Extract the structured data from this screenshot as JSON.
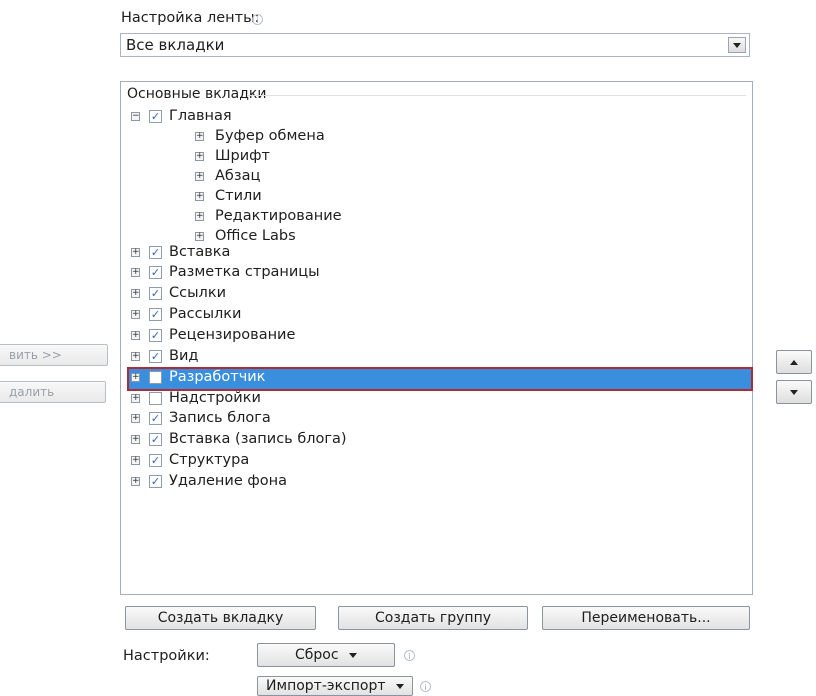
{
  "ribbon_setting": {
    "label": "Настройка ленты:",
    "selected": "Все вкладки"
  },
  "tree": {
    "header": "Основные вкладки",
    "rows": [
      {
        "label": "Главная",
        "level": 0,
        "expander": "−",
        "checked": true
      },
      {
        "label": "Буфер обмена",
        "level": 1,
        "expander": "+"
      },
      {
        "label": "Шрифт",
        "level": 1,
        "expander": "+"
      },
      {
        "label": "Абзац",
        "level": 1,
        "expander": "+"
      },
      {
        "label": "Стили",
        "level": 1,
        "expander": "+"
      },
      {
        "label": "Редактирование",
        "level": 1,
        "expander": "+"
      },
      {
        "label": "Office Labs",
        "level": 1,
        "expander": "+"
      },
      {
        "label": "Вставка",
        "level": 0,
        "expander": "+",
        "checked": true
      },
      {
        "label": "Разметка страницы",
        "level": 0,
        "expander": "+",
        "checked": true
      },
      {
        "label": "Ссылки",
        "level": 0,
        "expander": "+",
        "checked": true
      },
      {
        "label": "Рассылки",
        "level": 0,
        "expander": "+",
        "checked": true
      },
      {
        "label": "Рецензирование",
        "level": 0,
        "expander": "+",
        "checked": true
      },
      {
        "label": "Вид",
        "level": 0,
        "expander": "+",
        "checked": true
      },
      {
        "label": "Разработчик",
        "level": 0,
        "expander": "+",
        "checked": false,
        "selected": true
      },
      {
        "label": "Надстройки",
        "level": 0,
        "expander": "+",
        "checked": false
      },
      {
        "label": "Запись блога",
        "level": 0,
        "expander": "+",
        "checked": true
      },
      {
        "label": "Вставка (запись блога)",
        "level": 0,
        "expander": "+",
        "checked": true
      },
      {
        "label": "Структура",
        "level": 0,
        "expander": "+",
        "checked": true
      },
      {
        "label": "Удаление фона",
        "level": 0,
        "expander": "+",
        "checked": true
      }
    ]
  },
  "side_buttons": {
    "add": "вить >>",
    "remove": "далить"
  },
  "bottom_buttons": {
    "new_tab": "Создать вкладку",
    "new_group": "Создать группу",
    "rename": "Переименовать..."
  },
  "settings": {
    "label": "Настройки:",
    "reset": "Сброс",
    "import_export": "Импорт-экспорт"
  },
  "colors": {
    "selection": "#3a8ede",
    "selection_border": "#b12b35",
    "check": "#2a62b8"
  },
  "icons": {
    "info": "info-icon",
    "dropdown": "chevron-down-icon",
    "move_up": "move-up-icon",
    "move_down": "move-down-icon"
  }
}
